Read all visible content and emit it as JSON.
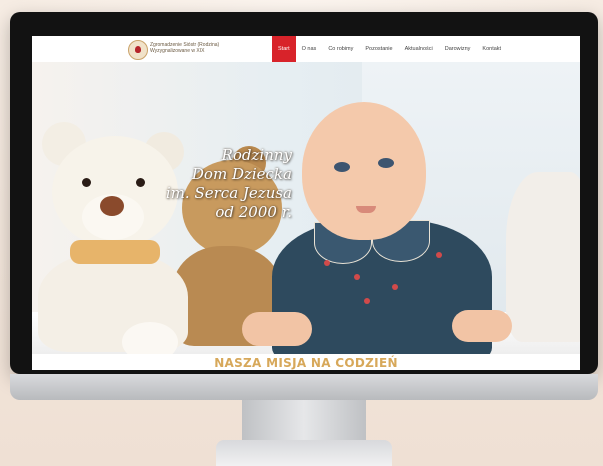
{
  "site": {
    "org_name_line1": "Zgromadzenie Sióstr (Rodzina)",
    "org_name_line2": "Wyzygnalizowane w XIX",
    "nav": [
      {
        "label": "Start",
        "active": true
      },
      {
        "label": "O nas"
      },
      {
        "label": "Co robimy"
      },
      {
        "label": "Pozostanie"
      },
      {
        "label": "Aktualności"
      },
      {
        "label": "Darowizny"
      },
      {
        "label": "Kontakt"
      }
    ]
  },
  "hero": {
    "title_lines": [
      "Rodzinny",
      "Dom Dziecka",
      "im. Serca Jezusa",
      "od 2000 r."
    ]
  },
  "mission": {
    "heading": "NASZA MISJA NA CODZIEŃ"
  },
  "colors": {
    "accent_red": "#d8232a",
    "mission_gold": "#d7a85a",
    "background": "#f3e7dc"
  }
}
